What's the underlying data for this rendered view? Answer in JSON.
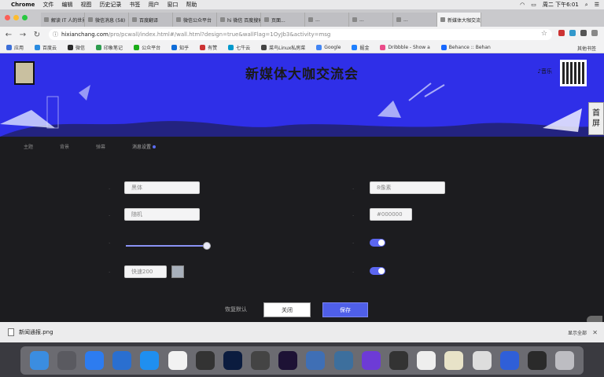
{
  "menubar": {
    "app": "Chrome",
    "items": [
      "文件",
      "编辑",
      "视图",
      "历史记录",
      "书签",
      "用户",
      "窗口",
      "帮助"
    ],
    "clock": "周二 下午6:01"
  },
  "tabs": [
    {
      "label": "解读 IT 人的世界 不会玩"
    },
    {
      "label": "微信消息 (58)"
    },
    {
      "label": "百度翻译"
    },
    {
      "label": "微信公众平台"
    },
    {
      "label": "hi 微信 百度搜索"
    },
    {
      "label": "页面..."
    },
    {
      "label": "..."
    },
    {
      "label": "..."
    },
    {
      "label": "..."
    },
    {
      "label": "新媒体大咖交流会 - 活动"
    }
  ],
  "address": {
    "domain": "hixianchang.com",
    "path": "/pro/pcwall/index.html#/wall.html?design=true&wallFlag=1OyJb3&activity=msg"
  },
  "bookmarks": [
    "应用",
    "百度云",
    "微信",
    "印象笔记",
    "公众平台",
    "知乎",
    "有赞",
    "七牛云",
    "菜鸟Linux私房菜",
    "Google",
    "掘金",
    "Dribbble - Show a",
    "Behance :: Behan"
  ],
  "bookmarks_right": "其他书签",
  "banner": {
    "title": "新媒体大咖交流会",
    "music_label": "音乐",
    "side_tab": [
      "首",
      "屏"
    ]
  },
  "settings": {
    "sub_tabs": [
      "主题",
      "背景",
      "弹幕",
      "消息设置"
    ],
    "fields": {
      "font": "黑体",
      "size": "8像素",
      "color": "随机",
      "hex": "#000000",
      "speed": "快速200"
    }
  },
  "actions": {
    "reset": "恢复默认",
    "close": "关闭",
    "save": "保存"
  },
  "downloads": {
    "file": "新闻通报.png",
    "show_all": "显示全部"
  },
  "dock": [
    {
      "name": "Finder",
      "color": "#3b8de0"
    },
    {
      "name": "Launchpad",
      "color": "#5a5a60"
    },
    {
      "name": "App Store",
      "color": "#2d7cf0"
    },
    {
      "name": "Xcode",
      "color": "#2a6fd0"
    },
    {
      "name": "Safari",
      "color": "#1f8ff0"
    },
    {
      "name": "Calendar",
      "color": "#f2f2f2"
    },
    {
      "name": "Music",
      "color": "#333"
    },
    {
      "name": "Ps",
      "color": "#0b1c3f"
    },
    {
      "name": "Sketch",
      "color": "#444"
    },
    {
      "name": "Pr",
      "color": "#1d1235"
    },
    {
      "name": "Keynote",
      "color": "#3f6fb5"
    },
    {
      "name": "Browser",
      "color": "#3d6f9d"
    },
    {
      "name": "Webstorm",
      "color": "#6d3bd6"
    },
    {
      "name": "Skype",
      "color": "#333"
    },
    {
      "name": "WeChat",
      "color": "#eee"
    },
    {
      "name": "Notes",
      "color": "#e8e3c8"
    },
    {
      "name": "Preview",
      "color": "#ddd"
    },
    {
      "name": "Baidu",
      "color": "#2f5fd8"
    },
    {
      "name": "QuickTime",
      "color": "#2a2a2a"
    },
    {
      "name": "Trash",
      "color": "#bdbdc2"
    }
  ]
}
